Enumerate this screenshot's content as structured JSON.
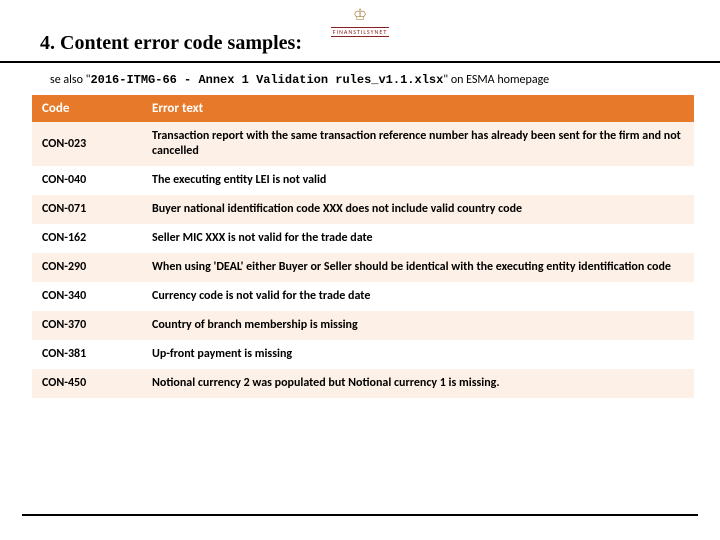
{
  "logo": {
    "brand": "FINANSTILSYNET"
  },
  "title": "4. Content error code samples:",
  "subtitle": {
    "prefix": "se also \"",
    "filename": "2016-ITMG-66 - Annex 1 Validation rules_v1.1.xlsx",
    "suffix": "\" on ESMA homepage"
  },
  "table": {
    "headers": {
      "code": "Code",
      "text": "Error text"
    },
    "rows": [
      {
        "code": "CON-023",
        "text": "Transaction report with the same transaction reference number has already been sent for the firm and not cancelled"
      },
      {
        "code": "CON-040",
        "text": "The executing entity LEI is not valid"
      },
      {
        "code": "CON-071",
        "text": "Buyer national identification code XXX does not include valid country code"
      },
      {
        "code": "CON-162",
        "text": "Seller MIC XXX is not valid for the trade date"
      },
      {
        "code": "CON-290",
        "text": "When using 'DEAL' either Buyer or Seller should be identical with the executing entity identification code"
      },
      {
        "code": "CON-340",
        "text": "Currency code is not valid for the trade date"
      },
      {
        "code": "CON-370",
        "text": "Country of branch membership is missing"
      },
      {
        "code": "CON-381",
        "text": "Up-front payment is missing"
      },
      {
        "code": "CON-450",
        "text": "Notional currency 2 was populated but Notional currency 1 is missing."
      }
    ]
  }
}
